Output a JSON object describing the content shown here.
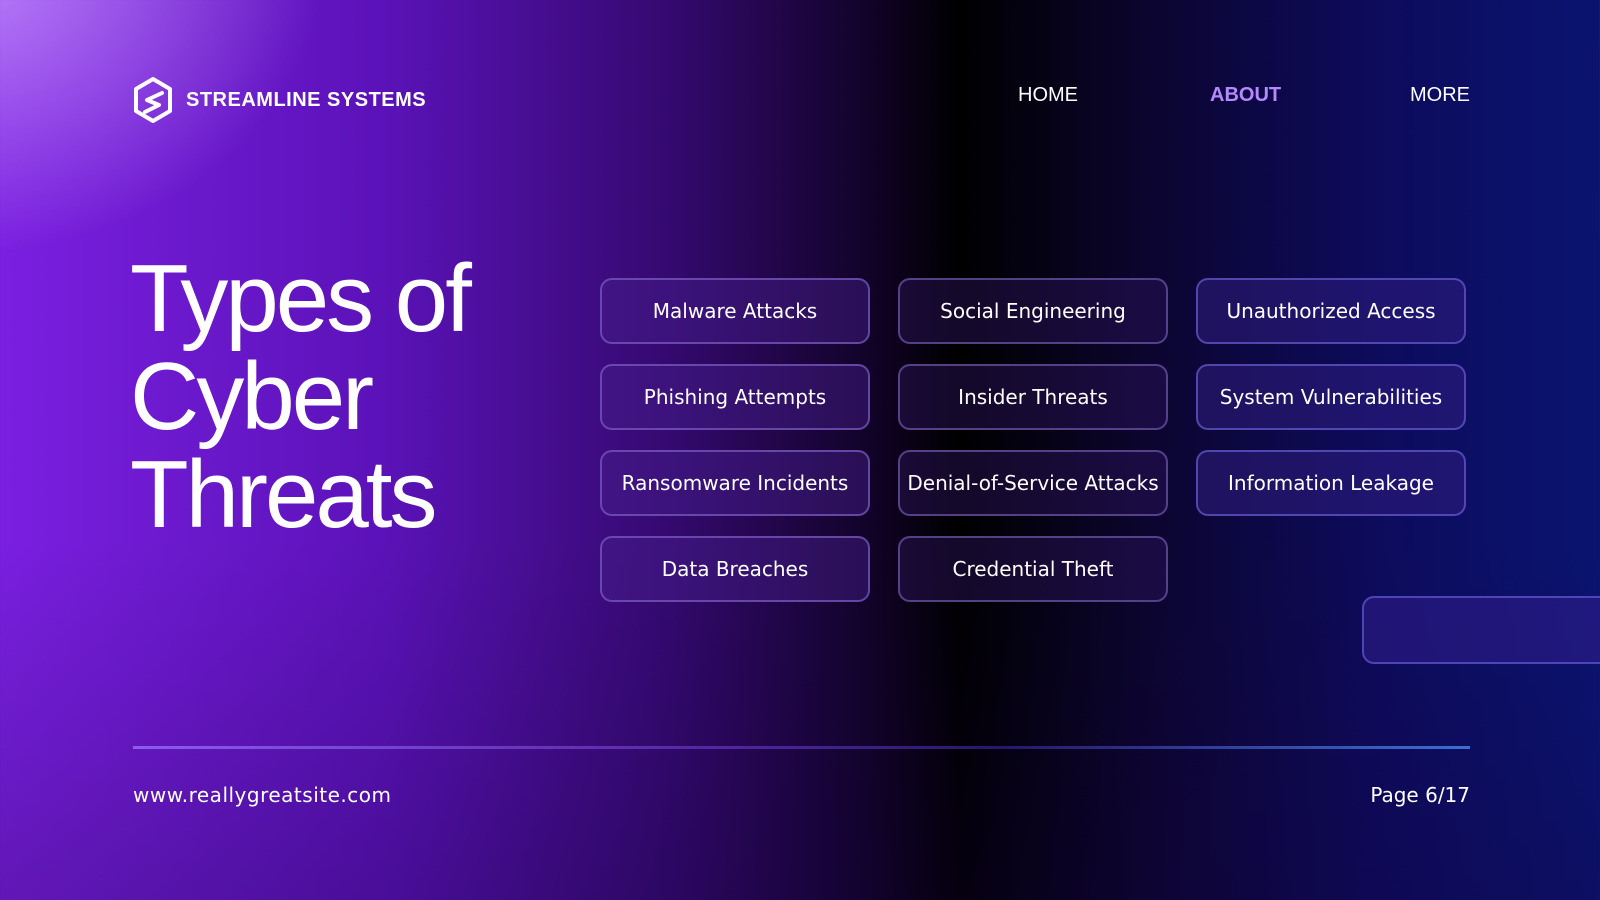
{
  "brand": {
    "name": "STREAMLINE SYSTEMS",
    "logo_icon": "hexagon-s-logo-icon"
  },
  "nav": {
    "items": [
      {
        "label": "HOME",
        "active": false
      },
      {
        "label": "ABOUT",
        "active": true
      },
      {
        "label": "MORE",
        "active": false
      }
    ]
  },
  "title": {
    "lines": [
      "Types of",
      "Cyber",
      "Threats"
    ]
  },
  "threats": [
    "Malware Attacks",
    "Social Engineering",
    "Unauthorized Access",
    "Phishing Attempts",
    "Insider Threats",
    "System Vulnerabilities",
    "Ransomware Incidents",
    "Denial-of-Service Attacks",
    "Information Leakage",
    "Data Breaches",
    "Credential Theft"
  ],
  "footer": {
    "url": "www.reallygreatsite.com",
    "page": "Page 6/17"
  },
  "colors": {
    "accent": "#b488ff",
    "text": "#ffffff"
  }
}
